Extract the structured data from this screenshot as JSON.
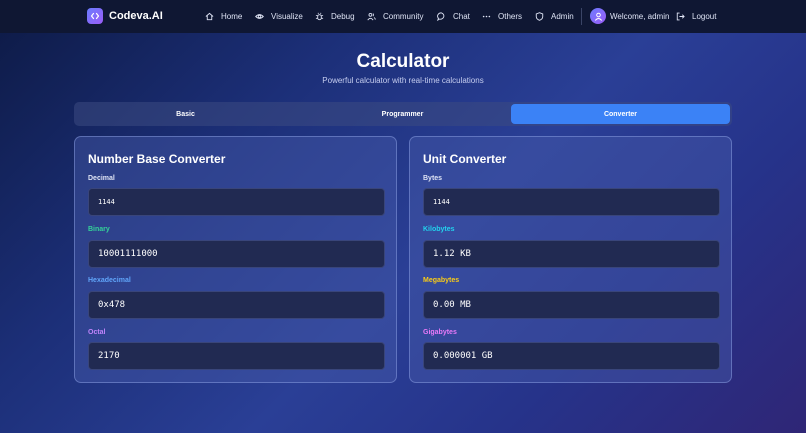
{
  "nav": {
    "brand": "Codeva.AI",
    "items": [
      {
        "label": "Home",
        "icon": "home-icon"
      },
      {
        "label": "Visualize",
        "icon": "eye-icon"
      },
      {
        "label": "Debug",
        "icon": "bug-icon"
      },
      {
        "label": "Community",
        "icon": "users-icon"
      },
      {
        "label": "Chat",
        "icon": "chat-icon"
      },
      {
        "label": "Others",
        "icon": "ellipsis-icon"
      },
      {
        "label": "Admin",
        "icon": "shield-icon"
      }
    ],
    "welcome": "Welcome, admin",
    "logout": "Logout"
  },
  "header": {
    "title": "Calculator",
    "subtitle": "Powerful calculator with real-time calculations"
  },
  "tabs": [
    {
      "label": "Basic",
      "active": false
    },
    {
      "label": "Programmer",
      "active": false
    },
    {
      "label": "Converter",
      "active": true
    }
  ],
  "base_converter": {
    "title": "Number Base Converter",
    "decimal": {
      "label": "Decimal",
      "value": "1144"
    },
    "binary": {
      "label": "Binary",
      "value": "10001111000"
    },
    "hexadecimal": {
      "label": "Hexadecimal",
      "value": "0x478"
    },
    "octal": {
      "label": "Octal",
      "value": "2170"
    }
  },
  "unit_converter": {
    "title": "Unit Converter",
    "bytes": {
      "label": "Bytes",
      "value": "1144"
    },
    "kilobytes": {
      "label": "Kilobytes",
      "value": "1.12 KB"
    },
    "megabytes": {
      "label": "Megabytes",
      "value": "0.00 MB"
    },
    "gigabytes": {
      "label": "Gigabytes",
      "value": "0.000001 GB"
    }
  },
  "colors": {
    "accent": "#3b82f6",
    "binary_label": "#34d399",
    "hex_label": "#60a5fa",
    "octal_label": "#c084fc",
    "kb_label": "#22d3ee",
    "mb_label": "#facc15",
    "gb_label": "#e879f9"
  }
}
